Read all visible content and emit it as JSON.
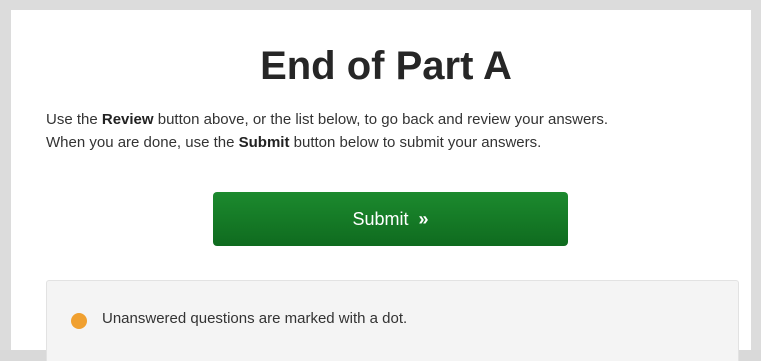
{
  "page": {
    "title": "End of Part A",
    "instructions": {
      "line1_before": "Use the ",
      "line1_bold": "Review",
      "line1_after": " button above, or the list below, to go back and review your answers.",
      "line2_before": "When you are done, use the ",
      "line2_bold": "Submit",
      "line2_after": " button below to submit your answers."
    },
    "submit_label": "Submit",
    "submit_icon": "»",
    "notice_text": "Unanswered questions are marked with a dot."
  },
  "colors": {
    "submit_green": "#137a25",
    "dot_orange": "#f0a030"
  },
  "icons": {
    "submit_icon": "double-chevron-right-icon",
    "notice_icon": "unanswered-dot-icon"
  }
}
